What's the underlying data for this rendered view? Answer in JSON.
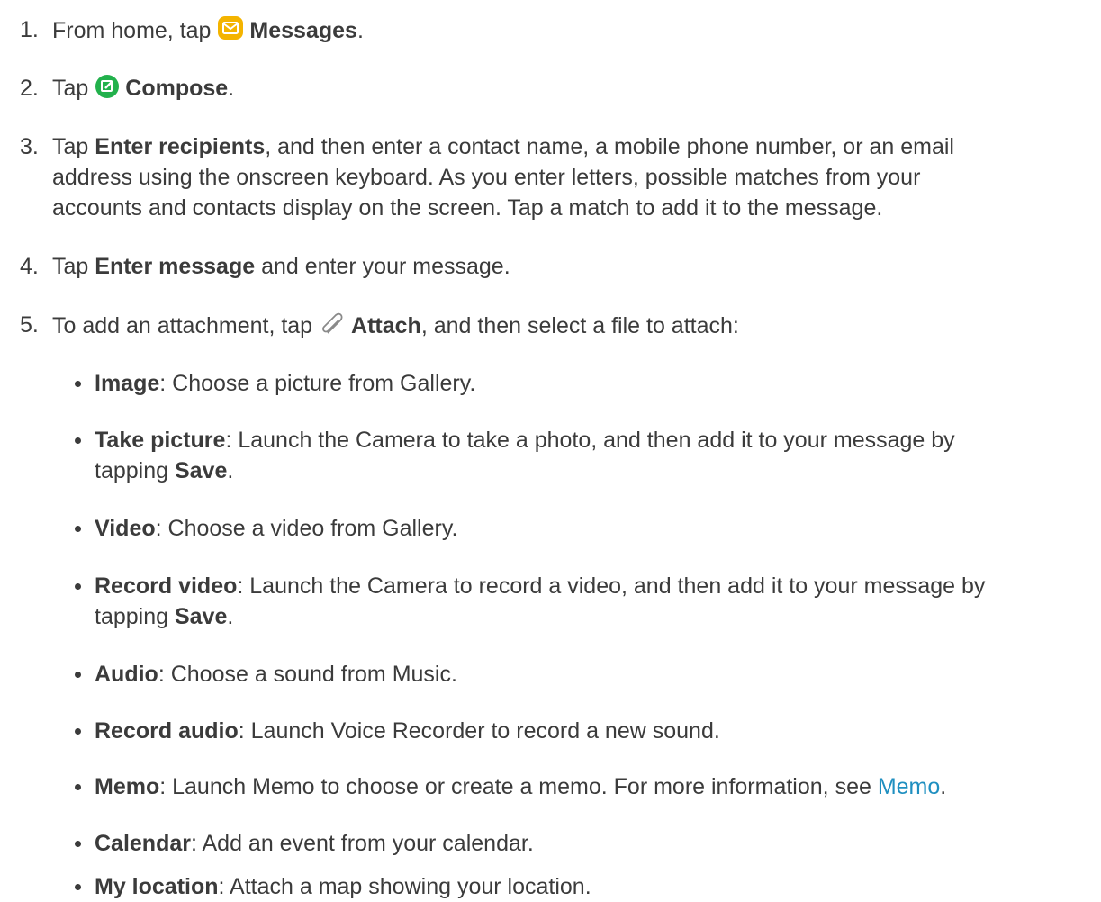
{
  "steps": [
    {
      "num": "1.",
      "pre": "From home, tap ",
      "bold": "Messages",
      "post": ".",
      "icon": "messages-icon"
    },
    {
      "num": "2.",
      "pre": "Tap ",
      "bold": "Compose",
      "post": ".",
      "icon": "compose-icon"
    },
    {
      "num": "3.",
      "pre": "Tap ",
      "bold": "Enter recipients",
      "post": ", and then enter a contact name, a mobile phone number, or an email",
      "line2": "address using the onscreen keyboard. As you enter letters, possible matches from your",
      "line3": "accounts and contacts display on the screen. Tap a match to add it to the message."
    },
    {
      "num": "4.",
      "pre": "Tap ",
      "bold": "Enter message",
      "post": " and enter your message."
    },
    {
      "num": "5.",
      "pre": "To add an attachment, tap ",
      "bold": "Attach",
      "post": ", and then select a file to attach:",
      "icon": "paperclip-icon"
    }
  ],
  "bullets": [
    {
      "bold": "Image",
      "text": ": Choose a picture from Gallery."
    },
    {
      "bold": "Take picture",
      "text": ": Launch the Camera to take a photo, and then add it to your message by",
      "line2_pre": "tapping ",
      "line2_bold": "Save",
      "line2_post": "."
    },
    {
      "bold": "Video",
      "text": ": Choose a video from Gallery."
    },
    {
      "bold": "Record video",
      "text": ": Launch the Camera to record a video, and then add it to your message by",
      "line2_pre": "tapping ",
      "line2_bold": "Save",
      "line2_post": "."
    },
    {
      "bold": "Audio",
      "text": ": Choose a sound from Music."
    },
    {
      "bold": "Record audio",
      "text": ": Launch Voice Recorder to record a new sound."
    },
    {
      "bold": "Memo",
      "text": ": Launch Memo to choose or create a memo. For more information, see ",
      "link": "Memo",
      "post": "."
    },
    {
      "bold": "Calendar",
      "text": ": Add an event from your calendar."
    },
    {
      "bold": "My location",
      "text": ": Attach a map showing your location."
    }
  ],
  "colors": {
    "text": "#3b3b3b",
    "link": "#1f8fc0",
    "messages_icon": "#f4b400",
    "compose_icon": "#22b14c"
  }
}
